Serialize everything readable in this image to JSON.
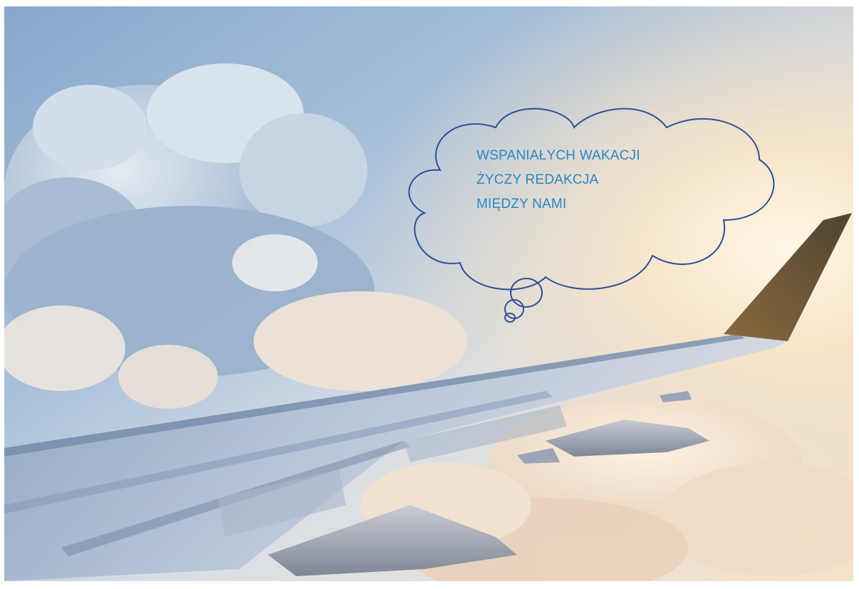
{
  "greeting": {
    "line1": "WSPANIAŁYCH WAKACJI",
    "line2": "ŻYCZY REDAKCJA",
    "line3": "MIĘDZY NAMI"
  },
  "colors": {
    "text": "#2a86c7",
    "bubble_outline": "#2e4e98",
    "sky_top": "#9fb9d4",
    "sun_glow": "#fbe9cf"
  }
}
